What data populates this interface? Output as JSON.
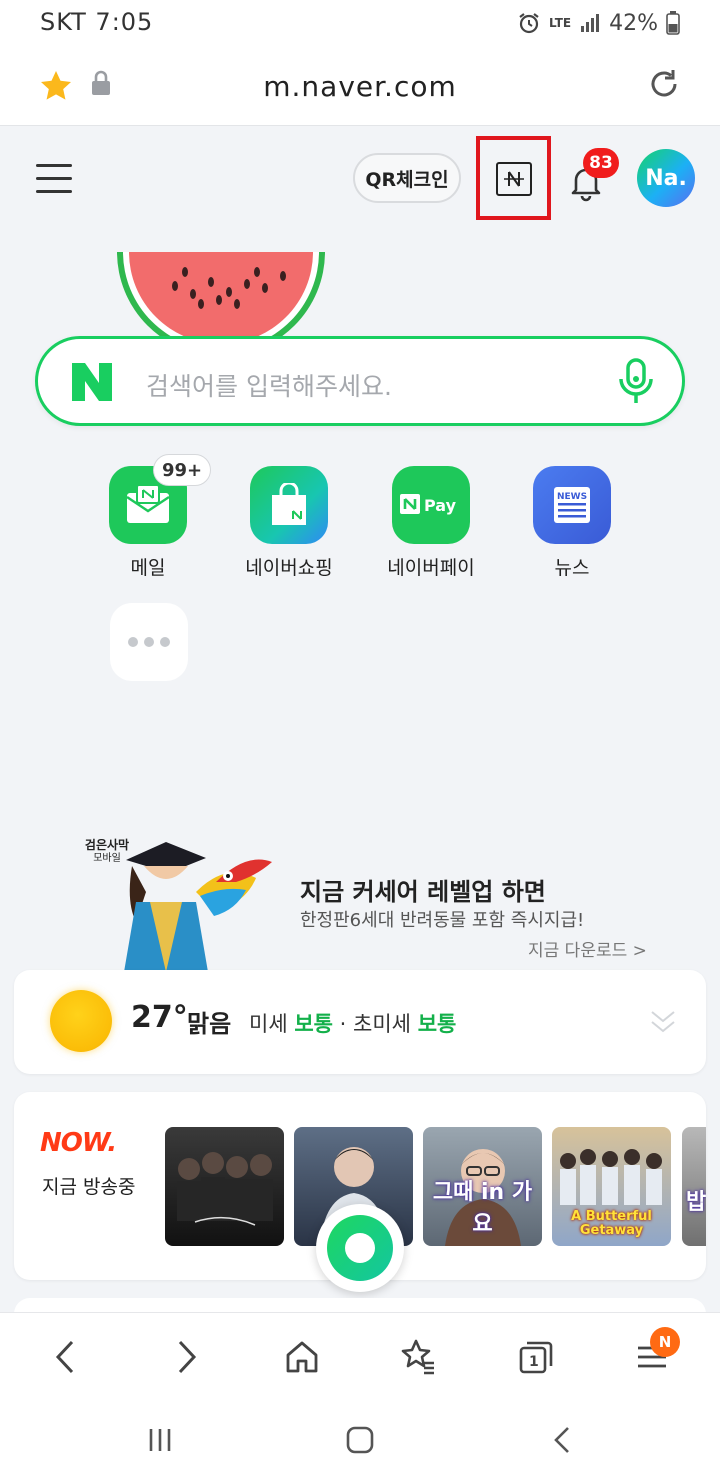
{
  "status_bar": {
    "carrier": "SKT",
    "time": "7:05",
    "network": "LTE",
    "battery": "42%"
  },
  "address_bar": {
    "url": "m.naver.com"
  },
  "top_nav": {
    "qr_label": "QR체크인",
    "notification_count": "83",
    "avatar_text": "Na."
  },
  "search": {
    "placeholder": "검색어를 입력해주세요."
  },
  "shortcuts": [
    {
      "label": "메일",
      "badge": "99+",
      "icon": "mail-icon",
      "color": "#1ec85a"
    },
    {
      "label": "네이버쇼핑",
      "icon": "shopping-bag-icon",
      "color": "#1ec85a"
    },
    {
      "label": "네이버페이",
      "icon": "npay-icon",
      "icon_text": "Pay",
      "color": "#1ec85a"
    },
    {
      "label": "뉴스",
      "icon": "news-icon",
      "icon_text": "NEWS",
      "color": "#4a6fe0"
    }
  ],
  "ad": {
    "game_title": "검은사막",
    "game_subtitle": "모바일",
    "headline": "지금 커세어 레벨업 하면",
    "subtext": "한정판6세대 반려동물 포함 즉시지급!",
    "link": "지금 다운로드 >"
  },
  "weather": {
    "temperature": "27°",
    "condition": "맑음",
    "fine_dust_label": "미세",
    "fine_dust_value": "보통",
    "separator": "·",
    "ultra_fine_dust_label": "초미세",
    "ultra_fine_dust_value": "보통"
  },
  "now": {
    "logo": "NOW.",
    "label": "지금 방송중",
    "thumbnails": [
      {
        "name": "now-thumb-group"
      },
      {
        "name": "now-thumb-portrait"
      },
      {
        "name": "now-thumb-show",
        "caption": "그때 in 가요"
      },
      {
        "name": "now-thumb-bts",
        "caption": "A Butterful Getaway"
      },
      {
        "name": "now-thumb-partial",
        "caption": "밥"
      }
    ]
  },
  "toolbar": {
    "menu_badge": "N"
  },
  "colors": {
    "naver_green": "#19ce60",
    "badge_red": "#f01c1c",
    "highlight_red": "#e0161d",
    "dust_good": "#13b04a"
  }
}
